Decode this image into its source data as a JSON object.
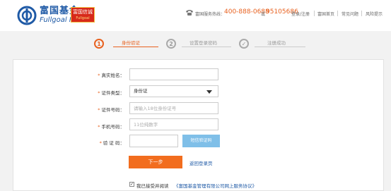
{
  "header": {
    "brand_cn": "富国基金",
    "brand_en": "Fullgoal Fund",
    "badge_line1": "富国信诚",
    "badge_line2": "Fullgoal",
    "hotline_label": "富国服务热线：",
    "hotline_number": "400-888-0688",
    "or_text": "或",
    "alt_number": "95105686",
    "login_register": "登录/注册",
    "nav_home": "富国首页",
    "nav_faq": "常见问题",
    "nav_risk": "风险提示"
  },
  "steps": [
    {
      "num": "1",
      "label": "身份验证",
      "active": true
    },
    {
      "num": "2",
      "label": "设置登录密码",
      "active": false
    },
    {
      "num": "✓",
      "label": "注册成功",
      "active": false
    }
  ],
  "form": {
    "name_label": "真实姓名：",
    "name_value": "",
    "id_type_label": "证件类型：",
    "id_type_value": "身份证",
    "id_number_label": "证件号码：",
    "id_number_placeholder": "请输入18位身份证号",
    "phone_label": "手机号码：",
    "phone_placeholder": "11位纯数字",
    "code_label": "验 证 码：",
    "code_value": "",
    "sms_button": "短信验证码",
    "next_button": "下一步",
    "back_link": "返回登录页"
  },
  "agreement": {
    "checked": true,
    "check_mark": "✓",
    "text": "我已接受并阅读",
    "link": "《富国基金管理有限公司网上服务协议》"
  },
  "colors": {
    "accent": "#e8611f",
    "brand_blue": "#1f5aa6",
    "sms_button": "#7fbfe8"
  }
}
